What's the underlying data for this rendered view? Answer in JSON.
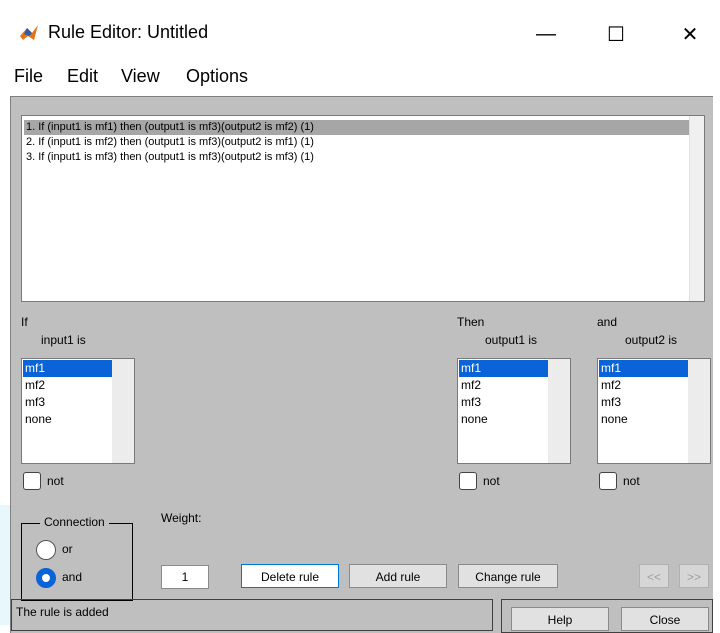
{
  "window": {
    "title": "Rule Editor: Untitled",
    "minimize_glyph": "—",
    "maximize_glyph": "☐",
    "close_glyph": "✕"
  },
  "menu": [
    "File",
    "Edit",
    "View",
    "Options"
  ],
  "rules": [
    "1. If (input1 is mf1) then (output1 is mf3)(output2 is mf2) (1)",
    "2. If (input1 is mf2) then (output1 is mf3)(output2 is mf1) (1)",
    "3. If (input1 is mf3) then (output1 is mf3)(output2 is mf3) (1)"
  ],
  "selected_rule_index": 0,
  "if_section": {
    "header": "If",
    "var_label": "input1 is",
    "options": [
      "mf1",
      "mf2",
      "mf3",
      "none"
    ],
    "selected": "mf1",
    "not_label": "not"
  },
  "then_section": {
    "header": "Then",
    "var_label": "output1 is",
    "options": [
      "mf1",
      "mf2",
      "mf3",
      "none"
    ],
    "selected": "mf1",
    "not_label": "not"
  },
  "and_section": {
    "header": "and",
    "var_label": "output2 is",
    "options": [
      "mf1",
      "mf2",
      "mf3",
      "none"
    ],
    "selected": "mf1",
    "not_label": "not"
  },
  "connection": {
    "title": "Connection",
    "options": [
      "or",
      "and"
    ],
    "selected": "and"
  },
  "weight": {
    "label": "Weight:",
    "value": "1"
  },
  "buttons": {
    "delete_rule": "Delete rule",
    "add_rule": "Add rule",
    "change_rule": "Change rule",
    "prev": "<<",
    "next": ">>",
    "help": "Help",
    "close": "Close"
  },
  "status": "The rule is added",
  "colors": {
    "panel": "#bfbfbf",
    "selection_blue": "#0a64d7",
    "rule_highlight": "#a6a6a6"
  }
}
